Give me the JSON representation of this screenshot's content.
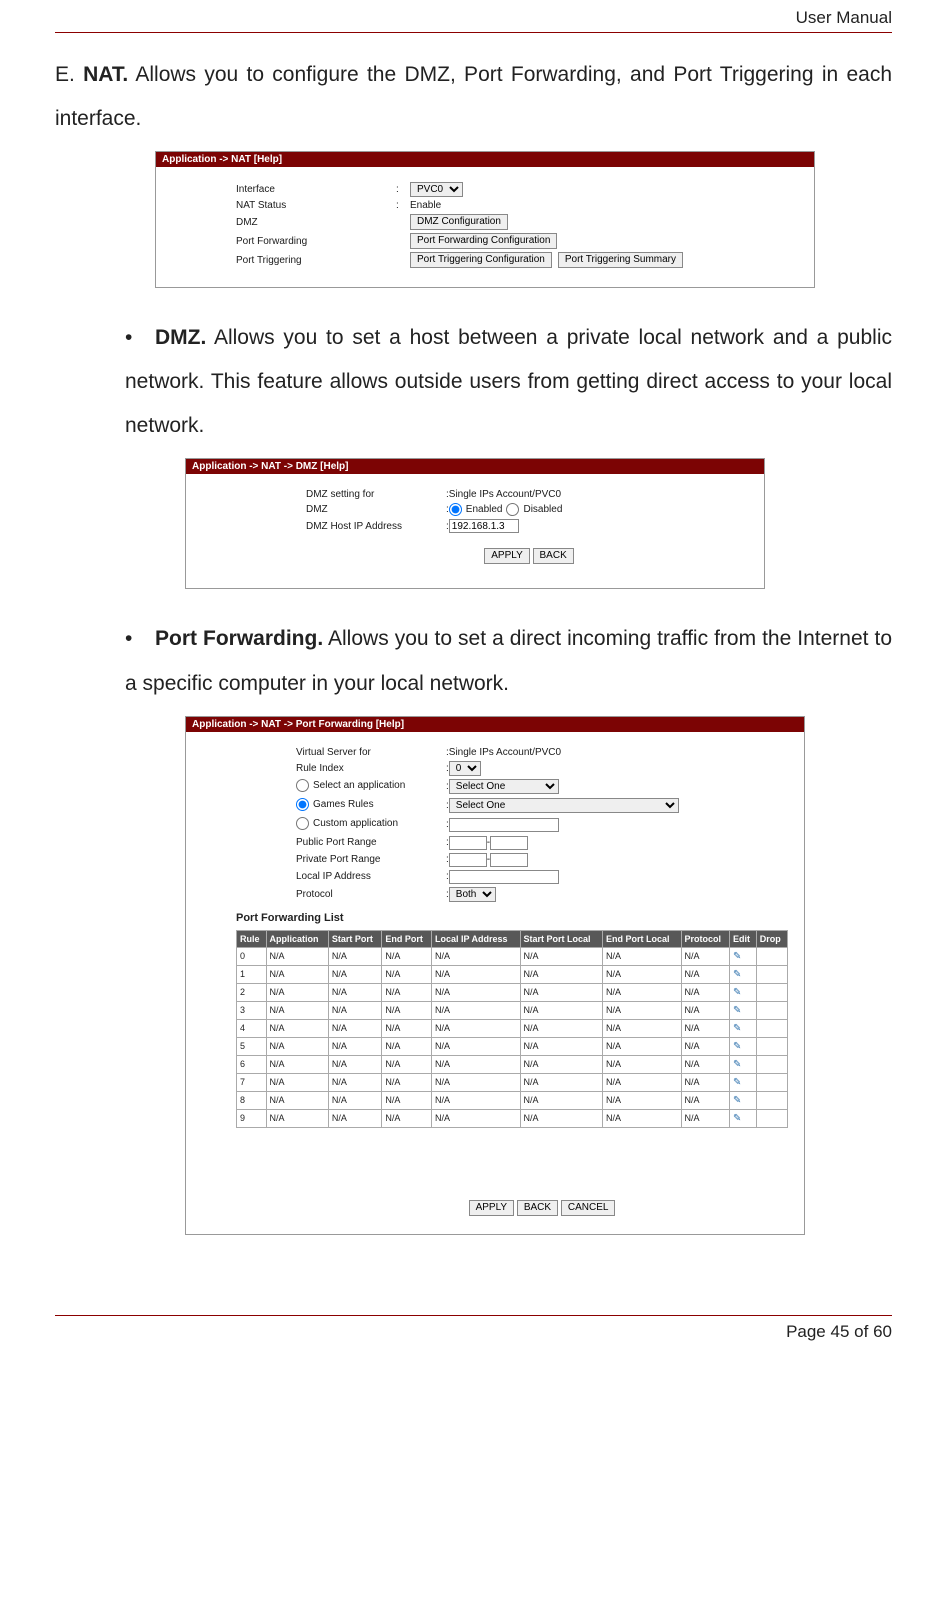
{
  "header": {
    "title": "User Manual"
  },
  "section": {
    "marker": "E.",
    "title": "NAT.",
    "body": " Allows you to configure the DMZ, Port Forwarding, and Port Triggering in each interface."
  },
  "fig1": {
    "title": "Application -> NAT [Help]",
    "rows": {
      "interface_lbl": "Interface",
      "interface_val": "PVC0",
      "natstatus_lbl": "NAT Status",
      "natstatus_val": "Enable",
      "dmz_lbl": "DMZ",
      "dmz_btn": "DMZ Configuration",
      "pf_lbl": "Port Forwarding",
      "pf_btn": "Port Forwarding Configuration",
      "pt_lbl": "Port Triggering",
      "pt_btn1": "Port Triggering Configuration",
      "pt_btn2": "Port Triggering Summary"
    }
  },
  "sub_dmz": {
    "title": "DMZ.",
    "body": " Allows you to set a host between a private local network and a public network. This feature allows outside users from getting direct access to your local network."
  },
  "fig2": {
    "title": "Application -> NAT -> DMZ [Help]",
    "rows": {
      "for_lbl": "DMZ setting for",
      "for_val": "Single IPs Account/PVC0",
      "dmz_lbl": "DMZ",
      "enabled": "Enabled",
      "disabled": "Disabled",
      "ip_lbl": "DMZ Host IP Address",
      "ip_val": "192.168.1.3",
      "apply": "APPLY",
      "back": "BACK"
    }
  },
  "sub_pf": {
    "title": "Port Forwarding.",
    "body": " Allows you to set a direct incoming traffic from the Internet to a specific computer in your local network."
  },
  "fig3": {
    "title": "Application -> NAT -> Port Forwarding [Help]",
    "rows": {
      "vs_lbl": "Virtual Server for",
      "vs_val": "Single IPs Account/PVC0",
      "ri_lbl": "Rule Index",
      "ri_val": "0",
      "selapp_lbl": "Select an application",
      "selapp_val": "Select One",
      "games_lbl": "Games Rules",
      "games_val": "Select One",
      "custom_lbl": "Custom application",
      "ppr_lbl": "Public Port Range",
      "pvpr_lbl": "Private Port Range",
      "lip_lbl": "Local IP Address",
      "proto_lbl": "Protocol",
      "proto_val": "Both",
      "list_title": "Port Forwarding List",
      "apply": "APPLY",
      "back": "BACK",
      "cancel": "CANCEL"
    },
    "headers": [
      "Rule",
      "Application",
      "Start Port",
      "End Port",
      "Local IP Address",
      "Start Port Local",
      "End Port Local",
      "Protocol",
      "Edit",
      "Drop"
    ],
    "tablerows": [
      {
        "rule": "0",
        "app": "N/A",
        "sp": "N/A",
        "ep": "N/A",
        "ip": "N/A",
        "spl": "N/A",
        "epl": "N/A",
        "proto": "N/A"
      },
      {
        "rule": "1",
        "app": "N/A",
        "sp": "N/A",
        "ep": "N/A",
        "ip": "N/A",
        "spl": "N/A",
        "epl": "N/A",
        "proto": "N/A"
      },
      {
        "rule": "2",
        "app": "N/A",
        "sp": "N/A",
        "ep": "N/A",
        "ip": "N/A",
        "spl": "N/A",
        "epl": "N/A",
        "proto": "N/A"
      },
      {
        "rule": "3",
        "app": "N/A",
        "sp": "N/A",
        "ep": "N/A",
        "ip": "N/A",
        "spl": "N/A",
        "epl": "N/A",
        "proto": "N/A"
      },
      {
        "rule": "4",
        "app": "N/A",
        "sp": "N/A",
        "ep": "N/A",
        "ip": "N/A",
        "spl": "N/A",
        "epl": "N/A",
        "proto": "N/A"
      },
      {
        "rule": "5",
        "app": "N/A",
        "sp": "N/A",
        "ep": "N/A",
        "ip": "N/A",
        "spl": "N/A",
        "epl": "N/A",
        "proto": "N/A"
      },
      {
        "rule": "6",
        "app": "N/A",
        "sp": "N/A",
        "ep": "N/A",
        "ip": "N/A",
        "spl": "N/A",
        "epl": "N/A",
        "proto": "N/A"
      },
      {
        "rule": "7",
        "app": "N/A",
        "sp": "N/A",
        "ep": "N/A",
        "ip": "N/A",
        "spl": "N/A",
        "epl": "N/A",
        "proto": "N/A"
      },
      {
        "rule": "8",
        "app": "N/A",
        "sp": "N/A",
        "ep": "N/A",
        "ip": "N/A",
        "spl": "N/A",
        "epl": "N/A",
        "proto": "N/A"
      },
      {
        "rule": "9",
        "app": "N/A",
        "sp": "N/A",
        "ep": "N/A",
        "ip": "N/A",
        "spl": "N/A",
        "epl": "N/A",
        "proto": "N/A"
      }
    ]
  },
  "footer": {
    "page_label": "Page",
    "page_num": "45",
    "of": "of",
    "total": "60"
  }
}
